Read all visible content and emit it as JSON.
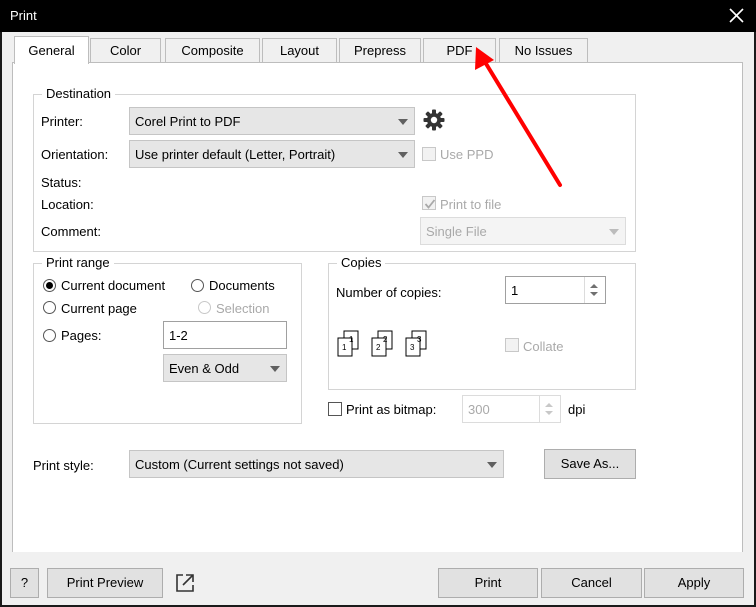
{
  "window": {
    "title": "Print",
    "close_icon": "close-icon"
  },
  "tabs": [
    {
      "label": "General",
      "active": true
    },
    {
      "label": "Color",
      "active": false
    },
    {
      "label": "Composite",
      "active": false
    },
    {
      "label": "Layout",
      "active": false
    },
    {
      "label": "Prepress",
      "active": false
    },
    {
      "label": "PDF",
      "active": false
    },
    {
      "label": "No Issues",
      "active": false
    }
  ],
  "destination": {
    "title": "Destination",
    "printer_label": "Printer:",
    "printer_value": "Corel Print to PDF",
    "orientation_label": "Orientation:",
    "orientation_value": "Use printer default (Letter, Portrait)",
    "use_ppd_label": "Use PPD",
    "status_label": "Status:",
    "location_label": "Location:",
    "print_to_file_label": "Print to file",
    "print_to_file_checked": true,
    "comment_label": "Comment:",
    "file_mode_value": "Single File",
    "settings_icon": "gear-icon"
  },
  "print_range": {
    "title": "Print range",
    "current_document": "Current document",
    "documents": "Documents",
    "current_page": "Current page",
    "selection": "Selection",
    "pages": "Pages:",
    "pages_value": "1-2",
    "even_odd_value": "Even & Odd",
    "selected": "current_document"
  },
  "copies": {
    "title": "Copies",
    "number_label": "Number of copies:",
    "number_value": "1",
    "collate_label": "Collate",
    "collate_icon": "collate-pages-icon",
    "page_numbers": [
      "1",
      "1",
      "2",
      "2",
      "3",
      "3"
    ]
  },
  "bitmap": {
    "label": "Print as bitmap:",
    "dpi_value": "300",
    "dpi_unit": "dpi"
  },
  "print_style": {
    "label": "Print style:",
    "value": "Custom (Current settings not saved)",
    "save_as": "Save As..."
  },
  "bottom": {
    "help": "?",
    "print_preview": "Print Preview",
    "print": "Print",
    "cancel": "Cancel",
    "apply": "Apply",
    "popout_icon": "popout-icon"
  },
  "annotation": {
    "arrow_color": "#ff0000",
    "arrow_icon": "red-arrow-annotation"
  },
  "colors": {
    "titlebar": "#000000",
    "dialog_bg": "#f0f0f0",
    "panel_bg": "#ffffff",
    "disabled_text": "#a9a9a9"
  }
}
